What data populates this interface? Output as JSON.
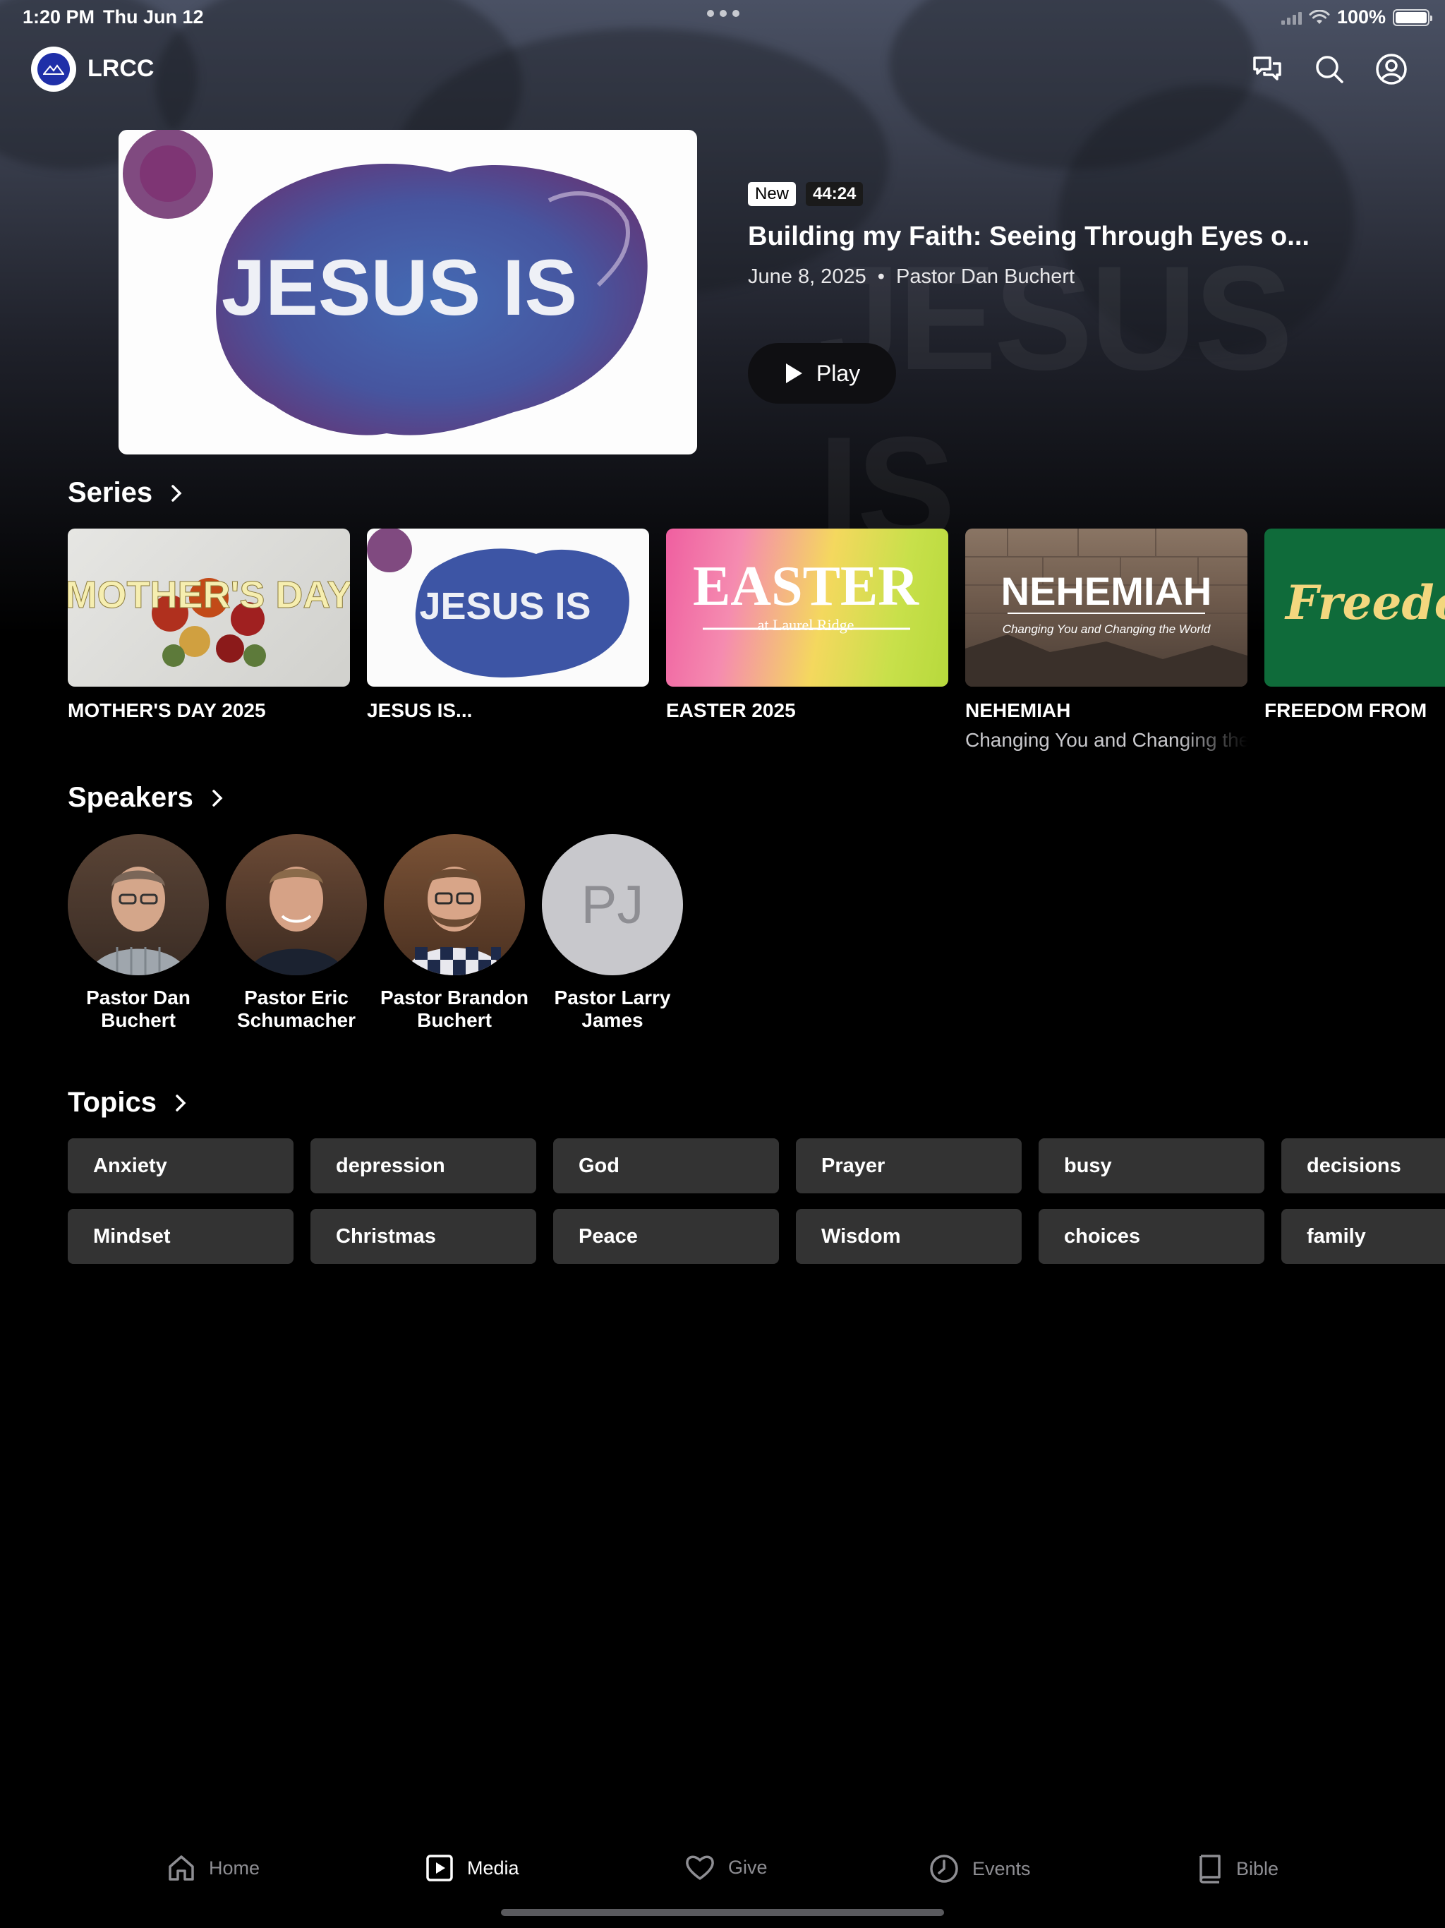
{
  "status_bar": {
    "time": "1:20 PM",
    "date": "Thu Jun 12",
    "battery": "100%",
    "battery_level": 1.0
  },
  "header": {
    "app_name": "LRCC",
    "actions": [
      {
        "name": "chat-icon"
      },
      {
        "name": "search-icon"
      },
      {
        "name": "account-icon"
      }
    ]
  },
  "featured": {
    "thumbnail_text": "JESUS IS",
    "badge_new": "New",
    "duration": "44:24",
    "title": "Building my Faith: Seeing Through Eyes o...",
    "date": "June 8, 2025",
    "separator": "•",
    "speaker": "Pastor Dan Buchert",
    "play_label": "Play"
  },
  "series": {
    "heading": "Series",
    "items": [
      {
        "title": "MOTHER'S DAY 2025",
        "art_text": "MOTHER'S DAY"
      },
      {
        "title": "JESUS IS...",
        "art_text": "JESUS IS"
      },
      {
        "title": "EASTER 2025",
        "art_text": "EASTER",
        "art_sub": "at Laurel Ridge"
      },
      {
        "title": "NEHEMIAH",
        "subtitle": "Changing You and Changing the World",
        "art_text": "NEHEMIAH",
        "art_sub": "Changing You and Changing the World"
      },
      {
        "title": "FREEDOM FROM",
        "art_text": "Freedom"
      }
    ]
  },
  "speakers": {
    "heading": "Speakers",
    "items": [
      {
        "name": "Pastor Dan Buchert"
      },
      {
        "name": "Pastor Eric Schumacher"
      },
      {
        "name": "Pastor Brandon Buchert"
      },
      {
        "name": "Pastor Larry James",
        "initials": "PJ"
      }
    ]
  },
  "topics": {
    "heading": "Topics",
    "row1": [
      "Anxiety",
      "depression",
      "God",
      "Prayer",
      "busy",
      "decisions"
    ],
    "row2": [
      "Mindset",
      "Christmas",
      "Peace",
      "Wisdom",
      "choices",
      "family"
    ]
  },
  "tab_bar": {
    "tabs": [
      {
        "label": "Home",
        "icon": "home-icon",
        "active": false
      },
      {
        "label": "Media",
        "icon": "media-icon",
        "active": true
      },
      {
        "label": "Give",
        "icon": "heart-icon",
        "active": false
      },
      {
        "label": "Events",
        "icon": "clock-icon",
        "active": false
      },
      {
        "label": "Bible",
        "icon": "book-icon",
        "active": false
      }
    ]
  },
  "colors": {
    "background": "#000000",
    "chip": "#333333",
    "inactive_tab": "#8e8e93",
    "freedom_green": "#0f6b3a",
    "freedom_text": "#f3d77e"
  }
}
